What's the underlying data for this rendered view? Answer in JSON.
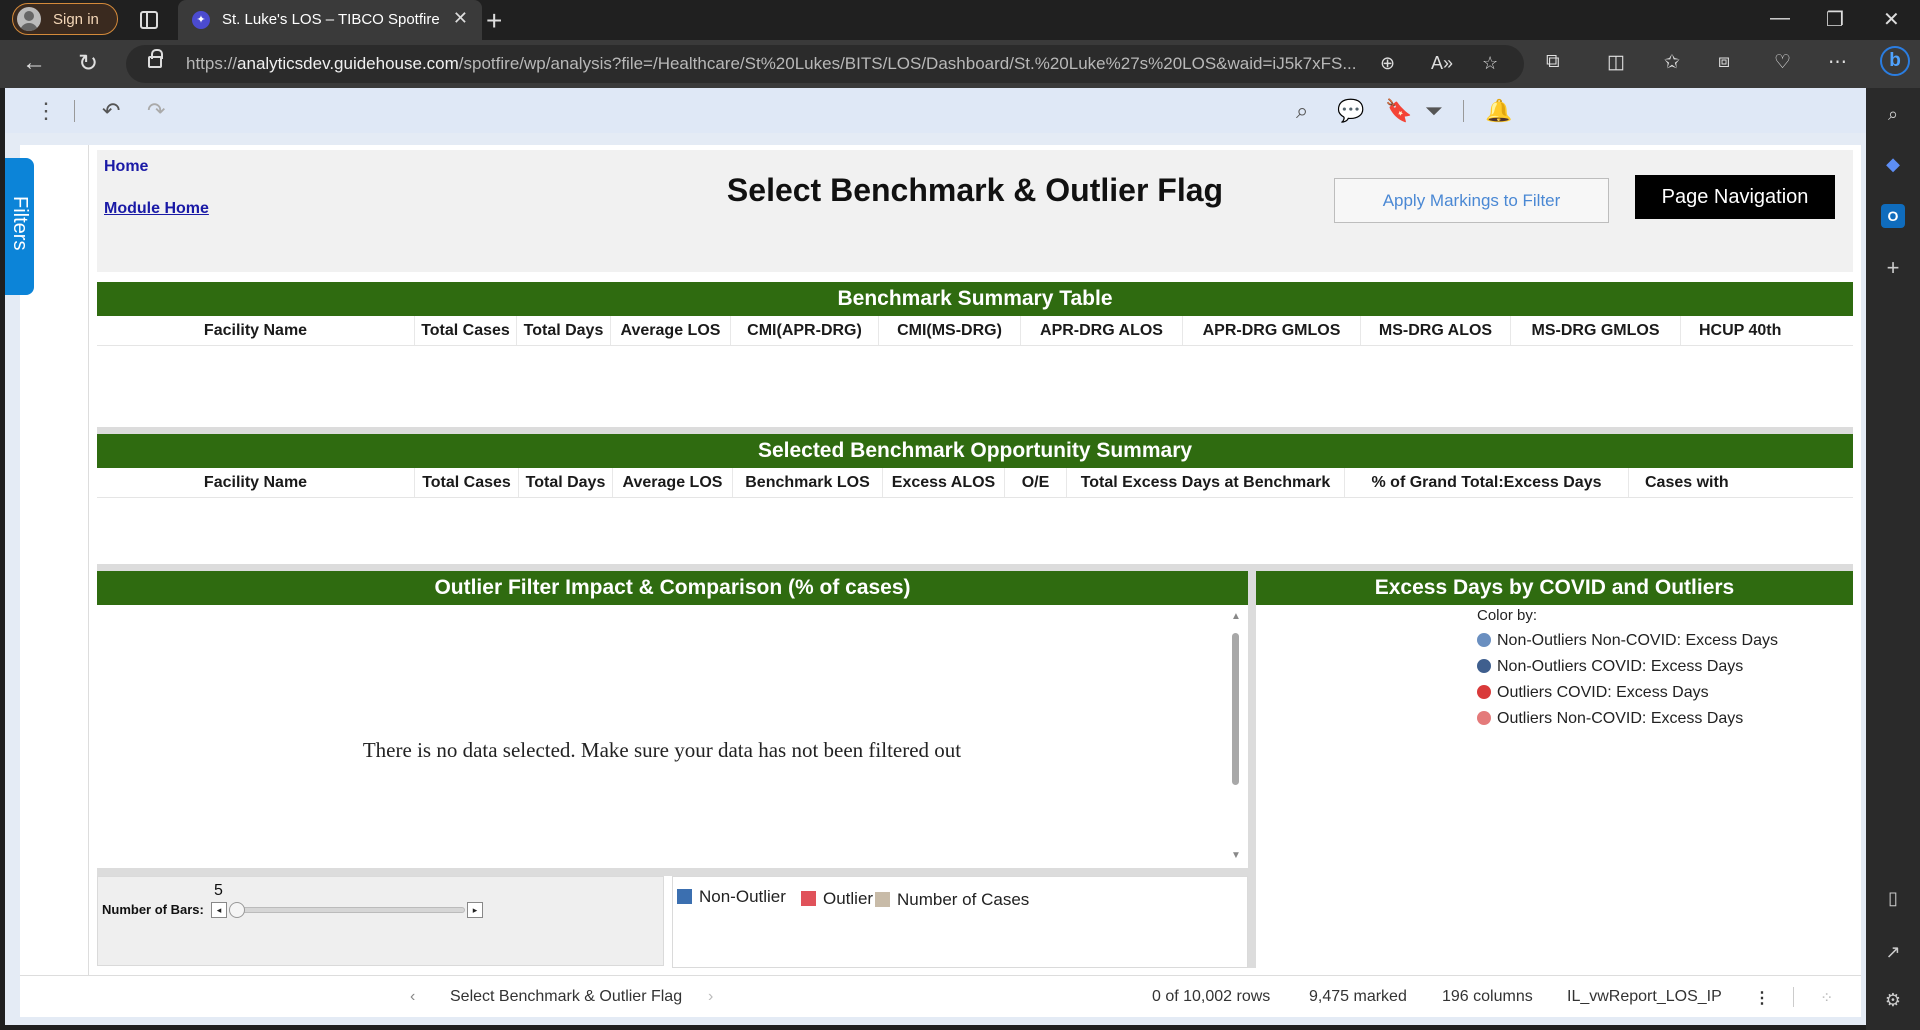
{
  "browser": {
    "signin_label": "Sign in",
    "tab_title": "St. Luke's LOS – TIBCO Spotfire",
    "url_scheme": "https://",
    "url_host": "analyticsdev.guidehouse.com",
    "url_path": "/spotfire/wp/analysis?file=/Healthcare/St%20Lukes/BITS/LOS/Dashboard/St.%20Luke%27s%20LOS&waid=iJ5k7xFS..."
  },
  "spotfire": {
    "filters_tab": "Filters"
  },
  "header": {
    "home_link": "Home",
    "module_home_link": "Module Home",
    "title": "Select Benchmark & Outlier Flag",
    "apply_button": "Apply Markings to Filter",
    "page_nav_button": "Page Navigation"
  },
  "benchmark_summary": {
    "title": "Benchmark Summary Table",
    "columns": [
      "Facility Name",
      "Total Cases",
      "Total Days",
      "Average LOS",
      "CMI(APR-DRG)",
      "CMI(MS-DRG)",
      "APR-DRG ALOS",
      "APR-DRG GMLOS",
      "MS-DRG ALOS",
      "MS-DRG GMLOS",
      "HCUP 40th"
    ]
  },
  "selected_summary": {
    "title": "Selected Benchmark Opportunity Summary",
    "columns": [
      "Facility Name",
      "Total Cases",
      "Total Days",
      "Average LOS",
      "Benchmark LOS",
      "Excess ALOS",
      "O/E",
      "Total Excess Days at Benchmark",
      "% of Grand Total:Excess Days",
      "Cases with"
    ]
  },
  "outlier_panel": {
    "title": "Outlier Filter Impact & Comparison (% of cases)",
    "no_data_message": "There is no data selected. Make sure your data has not been filtered out"
  },
  "bars_control": {
    "label": "Number of Bars:",
    "value": "5"
  },
  "outlier_legend": [
    {
      "label": "Non-Outlier",
      "color": "#3b6fb0"
    },
    {
      "label": "Outlier",
      "color": "#e0525a"
    },
    {
      "label": "Number of Cases",
      "color": "#c8bba8"
    }
  ],
  "excess_panel": {
    "title": "Excess Days by COVID and Outliers",
    "color_by_label": "Color by:",
    "legend": [
      {
        "label": "Non-Outliers Non-COVID: Excess Days",
        "color": "#6a8fc0"
      },
      {
        "label": "Non-Outliers COVID: Excess Days",
        "color": "#3f5f8e"
      },
      {
        "label": "Outliers COVID: Excess Days",
        "color": "#d93a3a"
      },
      {
        "label": "Outliers Non-COVID: Excess Days",
        "color": "#e47a7a"
      }
    ]
  },
  "status": {
    "page_name": "Select Benchmark & Outlier Flag",
    "rows": "0 of 10,002 rows",
    "marked": "9,475 marked",
    "columns": "196 columns",
    "table": "IL_vwReport_LOS_IP"
  }
}
